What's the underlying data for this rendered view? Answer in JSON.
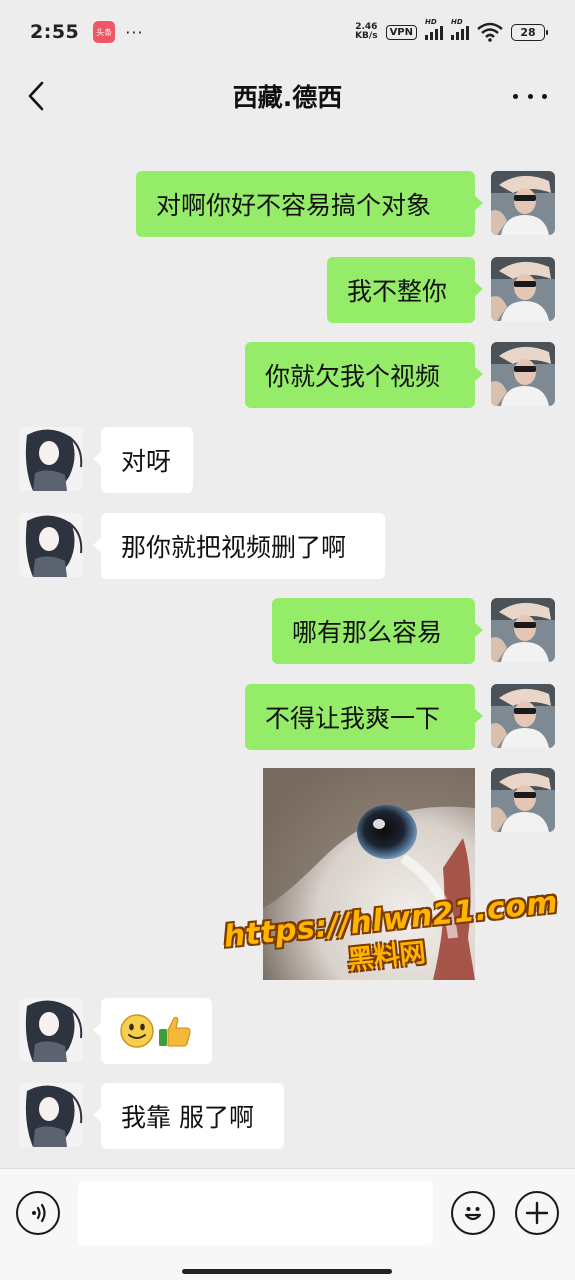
{
  "status_bar": {
    "time": "2:55",
    "app_badge": "头条",
    "more": "···",
    "net_speed_value": "2.46",
    "net_speed_unit": "KB/s",
    "vpn": "VPN",
    "signal_1_label": "HD",
    "signal_2_label": "HD",
    "battery": "28"
  },
  "header": {
    "title": "西藏.德西"
  },
  "messages": [
    {
      "from": "me",
      "text": "对啊你好不容易搞个对象"
    },
    {
      "from": "me",
      "text": "我不整你"
    },
    {
      "from": "me",
      "text": "你就欠我个视频"
    },
    {
      "from": "them",
      "text": "对呀"
    },
    {
      "from": "them",
      "text": "那你就把视频删了啊"
    },
    {
      "from": "me",
      "text": "哪有那么容易"
    },
    {
      "from": "me",
      "text": "不得让我爽一下"
    },
    {
      "from": "me",
      "type": "image",
      "description_icon": "cat-eye-sticker"
    },
    {
      "from": "them",
      "type": "emoji",
      "icons": [
        "smile-emoji",
        "thumbs-up-emoji"
      ]
    },
    {
      "from": "them",
      "text": "我靠 服了啊"
    }
  ],
  "watermark": {
    "url": "https://hlwn21.com",
    "site": "黑料网"
  },
  "input_bar": {
    "placeholder": ""
  },
  "colors": {
    "my_bubble": "#95ec69",
    "their_bubble": "#ffffff",
    "background": "#ededed",
    "watermark": "#ffb400"
  }
}
